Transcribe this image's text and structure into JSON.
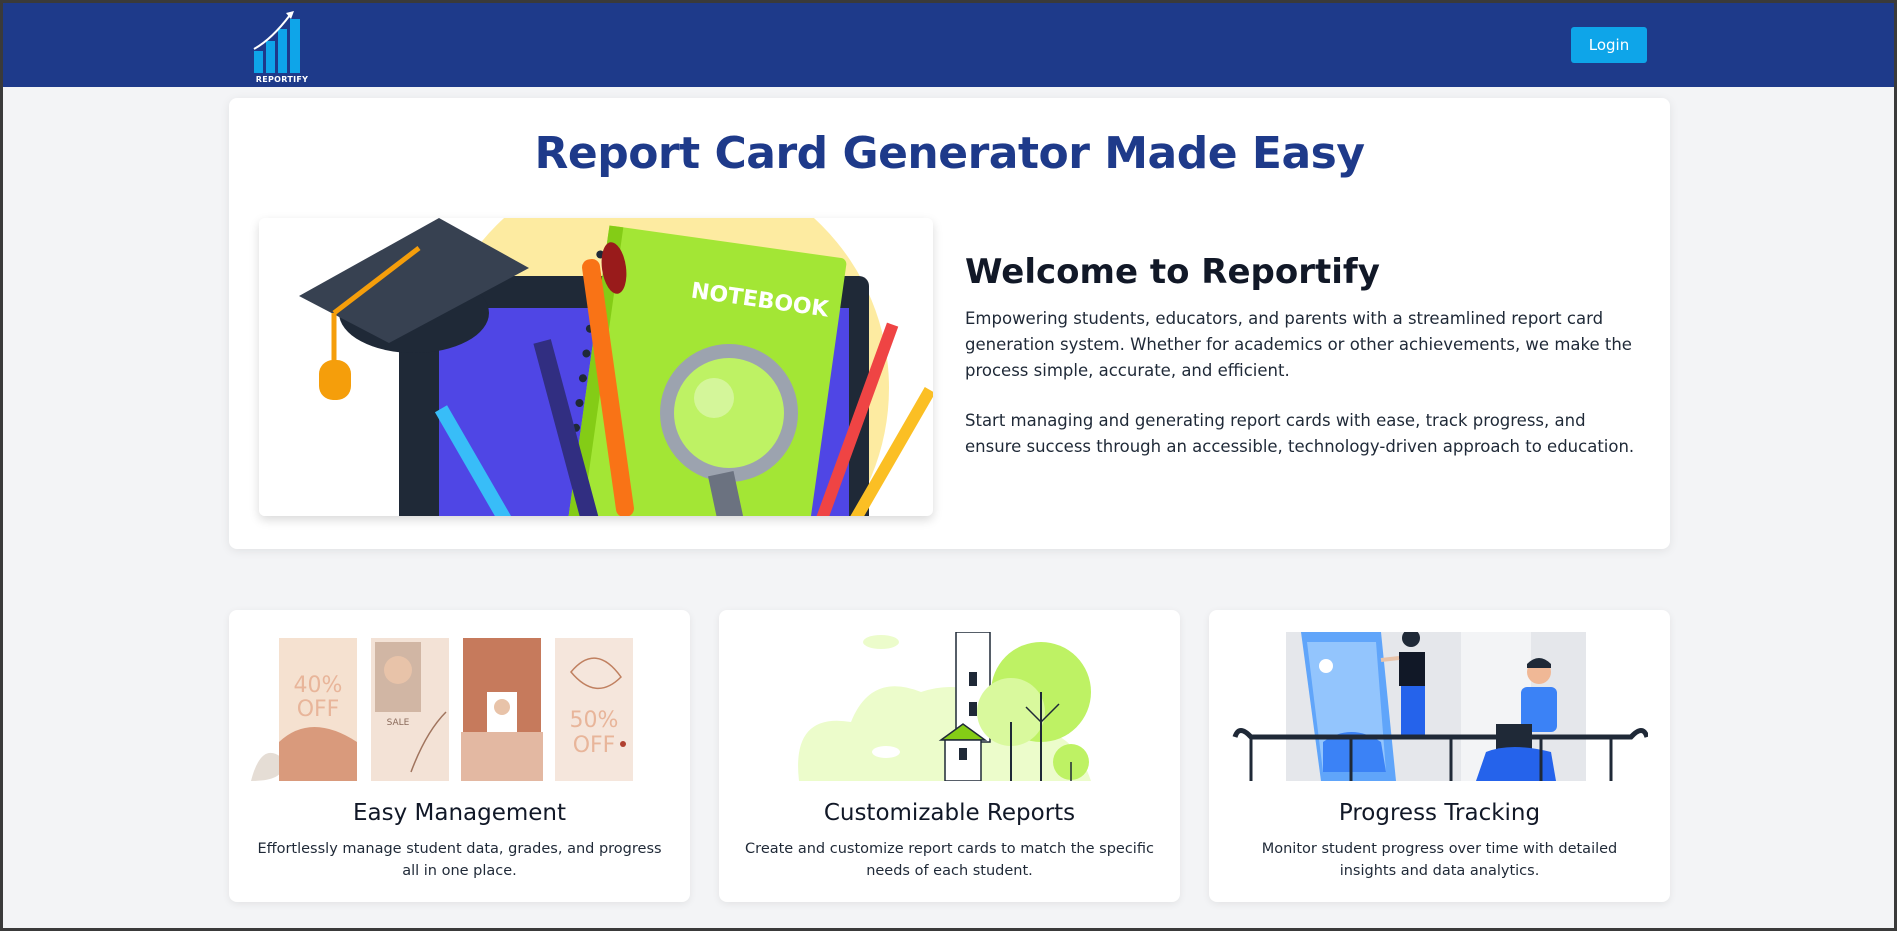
{
  "navbar": {
    "logo_text": "REPORTIFY",
    "login_label": "Login"
  },
  "hero": {
    "title": "Report Card Generator Made Easy",
    "image_label": "NOTEBOOK",
    "welcome_title": "Welcome to Reportify",
    "paragraph1": "Empowering students, educators, and parents with a streamlined report card generation system. Whether for academics or other achievements, we make the process simple, accurate, and efficient.",
    "paragraph2": "Start managing and generating report cards with ease, track progress, and ensure success through an accessible, technology-driven approach to education."
  },
  "features": [
    {
      "title": "Easy Management",
      "description": "Effortlessly manage student data, grades, and progress all in one place.",
      "image_texts": [
        "40%",
        "OFF",
        "SALE",
        "50%",
        "OFF"
      ]
    },
    {
      "title": "Customizable Reports",
      "description": "Create and customize report cards to match the specific needs of each student."
    },
    {
      "title": "Progress Tracking",
      "description": "Monitor student progress over time with detailed insights and data analytics."
    }
  ],
  "colors": {
    "navbar": "#1e3a8a",
    "accent": "#0ea5e9",
    "title": "#1e3a8a",
    "background": "#f3f4f6"
  },
  "icons": {
    "logo": "bar-chart-growth-icon"
  }
}
